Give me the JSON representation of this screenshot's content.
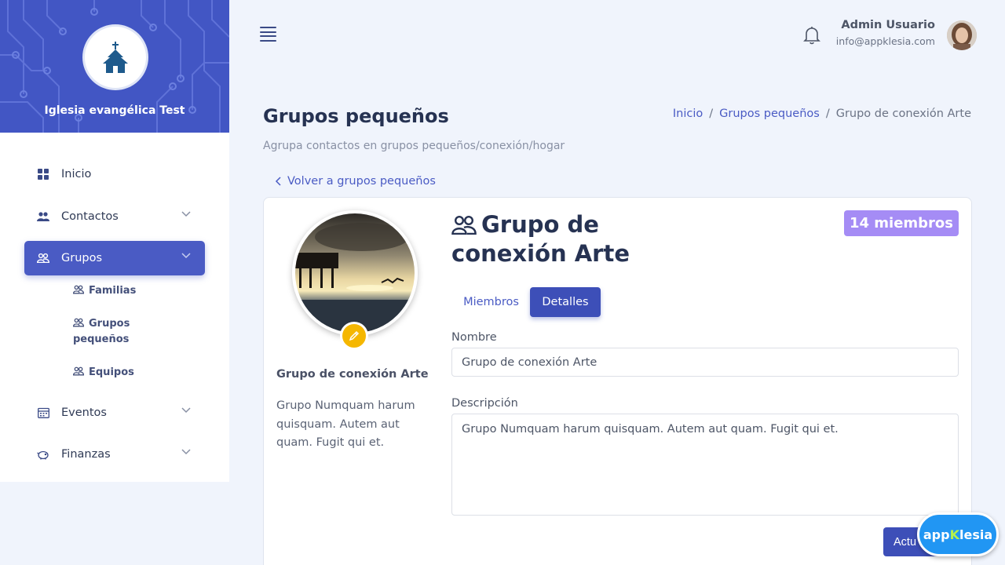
{
  "sidebar": {
    "church_name": "Iglesia evangélica Test",
    "items": [
      {
        "label": "Inicio",
        "icon": "grid-icon"
      },
      {
        "label": "Contactos",
        "icon": "users-icon"
      },
      {
        "label": "Grupos",
        "icon": "group-icon"
      },
      {
        "label": "Eventos",
        "icon": "calendar-icon"
      },
      {
        "label": "Finanzas",
        "icon": "piggy-bank-icon"
      }
    ],
    "subitems": [
      {
        "label": "Familias"
      },
      {
        "label": "Grupos pequeños"
      },
      {
        "label": "Equipos"
      }
    ]
  },
  "header": {
    "user_name": "Admin Usuario",
    "user_email": "info@appklesia.com"
  },
  "page": {
    "title": "Grupos pequeños",
    "subtitle": "Agrupa contactos en grupos pequeños/conexión/hogar",
    "breadcrumb": [
      "Inicio",
      "Grupos pequeños",
      "Grupo de conexión Arte"
    ],
    "breadcrumb_sep": "/",
    "back_link": "Volver a grupos pequeños"
  },
  "group": {
    "name": "Grupo de conexión Arte",
    "description": "Grupo Numquam harum quisquam. Autem aut quam. Fugit qui et.",
    "members_badge": "14 miembros",
    "tabs": [
      "Miembros",
      "Detalles"
    ],
    "active_tab": "Detalles"
  },
  "form": {
    "name_label": "Nombre",
    "name_value": "Grupo de conexión Arte",
    "description_label": "Descripción",
    "description_value": "Grupo Numquam harum quisquam. Autem aut quam. Fugit qui et.",
    "update_button": "Actu"
  },
  "brand": {
    "prefix": "app",
    "accent": "K",
    "suffix": "lesia"
  },
  "colors": {
    "primary": "#4a5bc4",
    "badge": "#a58cf5",
    "edit": "#f5b700",
    "background": "#f0f4fc"
  }
}
